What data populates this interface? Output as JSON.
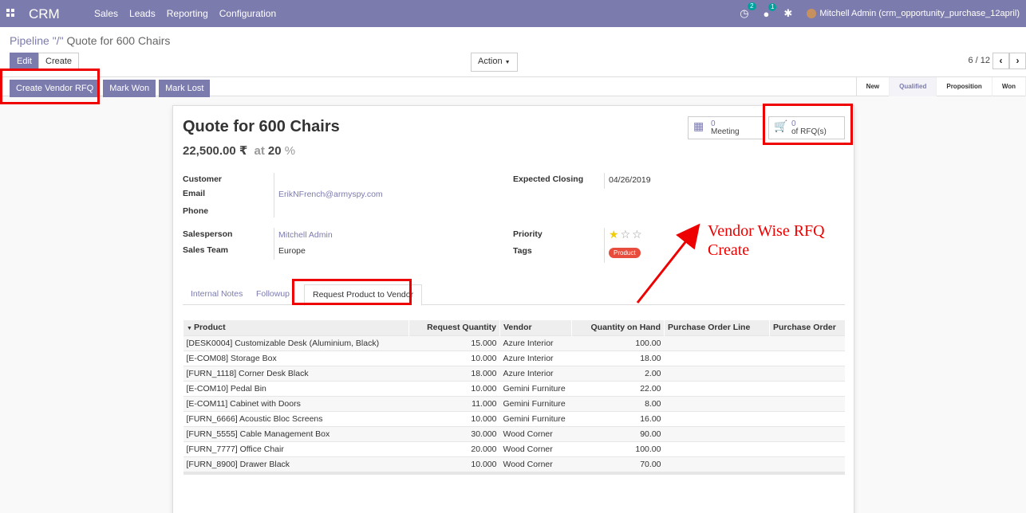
{
  "navbar": {
    "brand": "CRM",
    "menu": [
      "Sales",
      "Leads",
      "Reporting",
      "Configuration"
    ],
    "activity_badge": "2",
    "messages_badge": "1",
    "user": "Mitchell Admin (crm_opportunity_purchase_12april)"
  },
  "control": {
    "breadcrumb_parent": "Pipeline \"/\"",
    "breadcrumb_current": "Quote for 600 Chairs",
    "edit_label": "Edit",
    "create_label": "Create",
    "action_label": "Action",
    "pager": "6 / 12"
  },
  "statusbar": {
    "buttons": [
      "Create Vendor RFQ",
      "Mark Won",
      "Mark Lost"
    ],
    "stages": [
      "New",
      "Qualified",
      "Proposition",
      "Won"
    ],
    "active_stage": "Qualified"
  },
  "record": {
    "title": "Quote for 600 Chairs",
    "revenue": "22,500.00 ₹",
    "at": "at",
    "probability": "20",
    "probability_unit": "%",
    "meeting_count": "0",
    "meeting_label": "Meeting",
    "rfq_count": "0",
    "rfq_label": "of RFQ(s)",
    "labels": {
      "customer": "Customer",
      "email": "Email",
      "phone": "Phone",
      "salesperson": "Salesperson",
      "sales_team": "Sales Team",
      "expected_closing": "Expected Closing",
      "priority": "Priority",
      "tags": "Tags"
    },
    "email": "ErikNFrench@armyspy.com",
    "salesperson": "Mitchell Admin",
    "sales_team": "Europe",
    "expected_closing": "04/26/2019",
    "priority_stars": 1,
    "tag": "Product"
  },
  "tabs": [
    "Internal Notes",
    "Followup",
    "Request Product to Vendor"
  ],
  "table": {
    "headers": [
      "Product",
      "Request Quantity",
      "Vendor",
      "Quantity on Hand",
      "Purchase Order Line",
      "Purchase Order"
    ],
    "rows": [
      [
        "[DESK0004] Customizable Desk (Aluminium, Black)",
        "15.000",
        "Azure Interior",
        "100.00",
        "",
        ""
      ],
      [
        "[E-COM08] Storage Box",
        "10.000",
        "Azure Interior",
        "18.00",
        "",
        ""
      ],
      [
        "[FURN_1118] Corner Desk Black",
        "18.000",
        "Azure Interior",
        "2.00",
        "",
        ""
      ],
      [
        "[E-COM10] Pedal Bin",
        "10.000",
        "Gemini Furniture",
        "22.00",
        "",
        ""
      ],
      [
        "[E-COM11] Cabinet with Doors",
        "11.000",
        "Gemini Furniture",
        "8.00",
        "",
        ""
      ],
      [
        "[FURN_6666] Acoustic Bloc Screens",
        "10.000",
        "Gemini Furniture",
        "16.00",
        "",
        ""
      ],
      [
        "[FURN_5555] Cable Management Box",
        "30.000",
        "Wood Corner",
        "90.00",
        "",
        ""
      ],
      [
        "[FURN_7777] Office Chair",
        "20.000",
        "Wood Corner",
        "100.00",
        "",
        ""
      ],
      [
        "[FURN_8900] Drawer Black",
        "10.000",
        "Wood Corner",
        "70.00",
        "",
        ""
      ]
    ]
  },
  "annotation": {
    "line1": "Vendor Wise RFQ",
    "line2": "Create",
    "color": "#e00000"
  },
  "colors": {
    "brand": "#7c7bad",
    "tag": "#e74c3c",
    "star": "#f3cc00"
  }
}
